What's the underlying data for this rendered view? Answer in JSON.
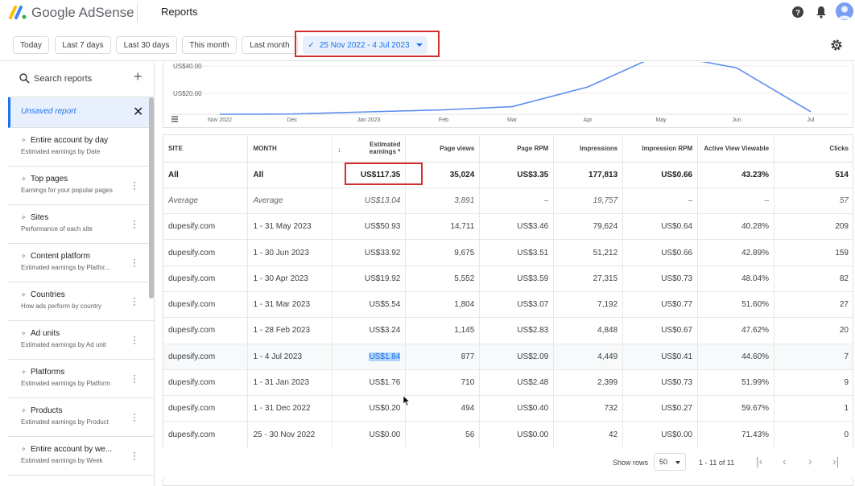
{
  "header": {
    "brand": "Google AdSense",
    "page_title": "Reports"
  },
  "date_filters": {
    "chips": [
      {
        "label": "Today"
      },
      {
        "label": "Last 7 days"
      },
      {
        "label": "Last 30 days"
      },
      {
        "label": "This month"
      },
      {
        "label": "Last month"
      }
    ],
    "selected_range": "25 Nov 2022 - 4 Jul 2023"
  },
  "sidebar": {
    "search_placeholder": "Search reports",
    "unsaved": "Unsaved report",
    "items": [
      {
        "title": "Entire account by day",
        "subtitle": "Estimated earnings by Date",
        "menu": false
      },
      {
        "title": "Top pages",
        "subtitle": "Earnings for your popular pages",
        "menu": true
      },
      {
        "title": "Sites",
        "subtitle": "Performance of each site",
        "menu": true
      },
      {
        "title": "Content platform",
        "subtitle": "Estimated earnings by Platfor...",
        "menu": true
      },
      {
        "title": "Countries",
        "subtitle": "How ads perform by country",
        "menu": true
      },
      {
        "title": "Ad units",
        "subtitle": "Estimated earnings by Ad unit",
        "menu": true
      },
      {
        "title": "Platforms",
        "subtitle": "Estimated earnings by Platform",
        "menu": true
      },
      {
        "title": "Products",
        "subtitle": "Estimated earnings by Product",
        "menu": true
      },
      {
        "title": "Entire account by we...",
        "subtitle": "Estimated earnings by Week",
        "menu": true
      }
    ]
  },
  "chart": {
    "y_ticks": [
      "US$40.00",
      "US$20.00"
    ],
    "x_ticks": [
      "Nov 2022",
      "Dec",
      "Jan 2023",
      "Feb",
      "Mar",
      "Apr",
      "May",
      "Jun",
      "Jul"
    ],
    "line_color": "#5b8def"
  },
  "chart_data": {
    "type": "line",
    "x": [
      "Nov 2022",
      "Dec",
      "Jan 2023",
      "Feb",
      "Mar",
      "Apr",
      "May",
      "Jun",
      "Jul"
    ],
    "series": [
      {
        "values": [
          0.0,
          0.2,
          1.76,
          3.24,
          5.54,
          19.92,
          50.93,
          33.92,
          1.84
        ]
      }
    ],
    "ylim": [
      0,
      50
    ]
  },
  "table": {
    "headers": [
      "SITE",
      "MONTH",
      "Estimated earnings *",
      "Page views",
      "Page RPM",
      "Impressions",
      "Impression RPM",
      "Active View Viewable",
      "Clicks"
    ],
    "total": [
      "All",
      "All",
      "US$117.35",
      "35,024",
      "US$3.35",
      "177,813",
      "US$0.66",
      "43.23%",
      "514"
    ],
    "average": [
      "Average",
      "Average",
      "US$13.04",
      "3,891",
      "–",
      "19,757",
      "–",
      "–",
      "57"
    ],
    "rows": [
      [
        "dupesify.com",
        "1 - 31 May 2023",
        "US$50.93",
        "14,711",
        "US$3.46",
        "79,624",
        "US$0.64",
        "40.28%",
        "209"
      ],
      [
        "dupesify.com",
        "1 - 30 Jun 2023",
        "US$33.92",
        "9,675",
        "US$3.51",
        "51,212",
        "US$0.66",
        "42.89%",
        "159"
      ],
      [
        "dupesify.com",
        "1 - 30 Apr 2023",
        "US$19.92",
        "5,552",
        "US$3.59",
        "27,315",
        "US$0.73",
        "48.04%",
        "82"
      ],
      [
        "dupesify.com",
        "1 - 31 Mar 2023",
        "US$5.54",
        "1,804",
        "US$3.07",
        "7,192",
        "US$0.77",
        "51.60%",
        "27"
      ],
      [
        "dupesify.com",
        "1 - 28 Feb 2023",
        "US$3.24",
        "1,145",
        "US$2.83",
        "4,848",
        "US$0.67",
        "47.62%",
        "20"
      ],
      [
        "dupesify.com",
        "1 - 4 Jul 2023",
        "US$1.84",
        "877",
        "US$2.09",
        "4,449",
        "US$0.41",
        "44.60%",
        "7"
      ],
      [
        "dupesify.com",
        "1 - 31 Jan 2023",
        "US$1.76",
        "710",
        "US$2.48",
        "2,399",
        "US$0.73",
        "51.99%",
        "9"
      ],
      [
        "dupesify.com",
        "1 - 31 Dec 2022",
        "US$0.20",
        "494",
        "US$0.40",
        "732",
        "US$0.27",
        "59.67%",
        "1"
      ],
      [
        "dupesify.com",
        "25 - 30 Nov 2022",
        "US$0.00",
        "56",
        "US$0.00",
        "42",
        "US$0.00",
        "71.43%",
        "0"
      ]
    ]
  },
  "pager": {
    "show_rows_label": "Show rows",
    "rows_value": "50",
    "range": "1 - 11 of 11"
  }
}
